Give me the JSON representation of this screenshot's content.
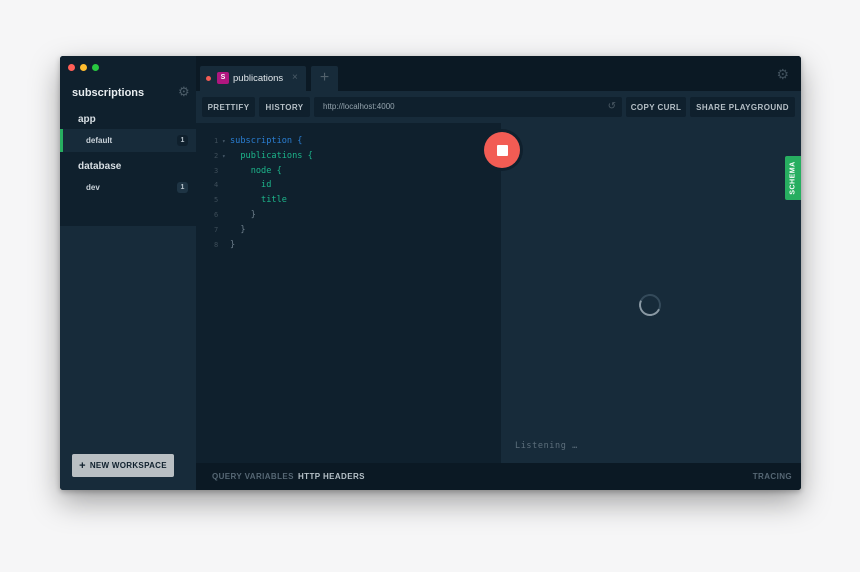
{
  "sidebar": {
    "workspace_title": "subscriptions",
    "projects": [
      {
        "name": "app",
        "stages": [
          {
            "label": "default",
            "count": "1",
            "active": true
          }
        ]
      },
      {
        "name": "database",
        "stages": [
          {
            "label": "dev",
            "count": "1",
            "active": false
          }
        ]
      }
    ],
    "new_workspace_label": "NEW WORKSPACE"
  },
  "tabs": [
    {
      "badge": "S",
      "title": "publications",
      "close": "×",
      "status_color": "#f25c54",
      "badge_color": "#b0167f"
    }
  ],
  "add_tab_label": "+",
  "toolbar": {
    "prettify_label": "PRETTIFY",
    "history_label": "HISTORY",
    "url_value": "http://localhost:4000",
    "copy_curl_label": "COPY CURL",
    "share_label": "SHARE PLAYGROUND"
  },
  "editor": {
    "lines": [
      {
        "n": "1",
        "fold": "▾",
        "text": "subscription {"
      },
      {
        "n": "2",
        "fold": "▾",
        "text": "publications {"
      },
      {
        "n": "3",
        "fold": "",
        "text": "node {"
      },
      {
        "n": "4",
        "fold": "",
        "text": "id"
      },
      {
        "n": "5",
        "fold": "",
        "text": "title"
      },
      {
        "n": "6",
        "fold": "",
        "text": "}"
      },
      {
        "n": "7",
        "fold": "",
        "text": "}"
      },
      {
        "n": "8",
        "fold": "",
        "text": "}"
      }
    ]
  },
  "result": {
    "schema_label": "SCHEMA",
    "status_text": "Listening …"
  },
  "bottom_bar": {
    "query_variables_label": "QUERY VARIABLES",
    "http_headers_label": "HTTP HEADERS",
    "tracing_label": "TRACING"
  },
  "colors": {
    "accent_green": "#27ae60",
    "run_red": "#f25c54",
    "keyword_blue": "#2a7ed2",
    "field_green": "#1db58b"
  }
}
